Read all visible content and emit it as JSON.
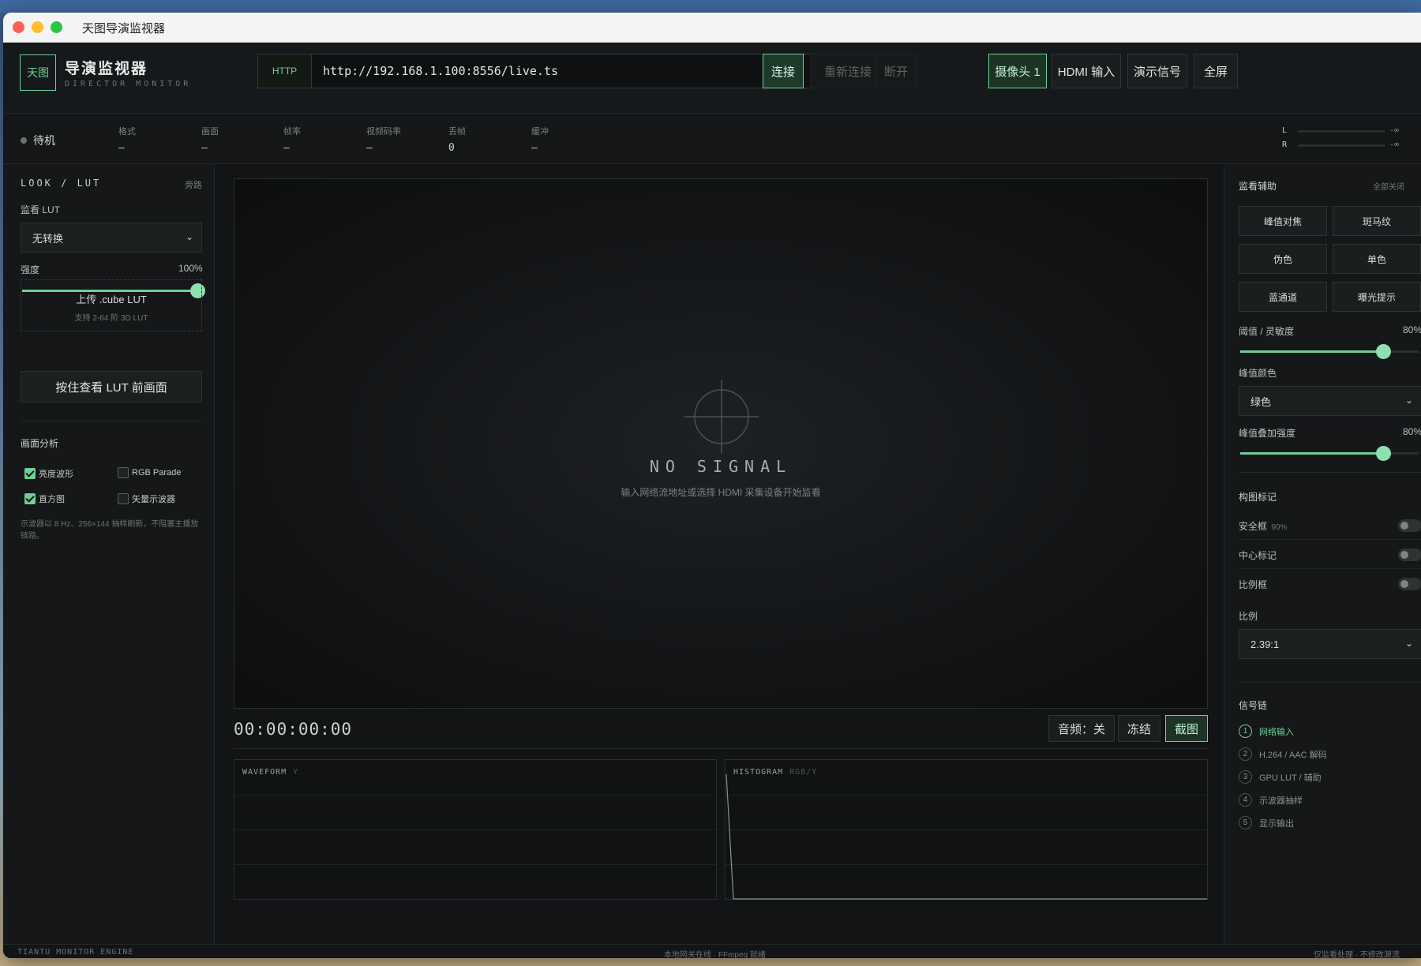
{
  "window": {
    "title": "天图导演监视器"
  },
  "header": {
    "logo": "天图",
    "app_title": "导演监视器",
    "app_subtitle": "DIRECTOR MONITOR",
    "protocol": "HTTP",
    "url": "http://192.168.1.100:8556/live.ts",
    "connect": "连接",
    "reconnect": "重新连接",
    "disconnect": "断开",
    "sources": [
      "摄像头 1",
      "HDMI 输入",
      "演示信号"
    ],
    "fullscreen": "全屏"
  },
  "status": {
    "state": "待机",
    "stats": [
      {
        "label": "格式",
        "value": "—"
      },
      {
        "label": "画面",
        "value": "—"
      },
      {
        "label": "帧率",
        "value": "—"
      },
      {
        "label": "视频码率",
        "value": "—"
      },
      {
        "label": "丢帧",
        "value": "0"
      },
      {
        "label": "缓冲",
        "value": "—"
      }
    ],
    "meters": [
      {
        "channel": "L",
        "value": "-∞",
        "level": 0
      },
      {
        "channel": "R",
        "value": "-∞",
        "level": 0
      }
    ]
  },
  "left": {
    "look_title": "LOOK / LUT",
    "bypass": "旁路",
    "lut_label": "监看 LUT",
    "lut_value": "无转换",
    "strength_label": "强度",
    "strength_value": "100%",
    "strength_level": 1.0,
    "upload_title": "上传 .cube LUT",
    "upload_sub": "支持 2-64 阶 3D LUT",
    "hold_button": "按住查看 LUT 前画面",
    "analysis_title": "画面分析",
    "checks": [
      {
        "label": "亮度波形",
        "checked": true
      },
      {
        "label": "RGB Parade",
        "checked": false
      },
      {
        "label": "直方图",
        "checked": true
      },
      {
        "label": "矢量示波器",
        "checked": false
      }
    ],
    "note": "示波器以 8 Hz、256×144 抽样刷新，不阻塞主播放链路。"
  },
  "center": {
    "no_signal": "NO SIGNAL",
    "hint": "输入网络流地址或选择 HDMI 采集设备开始监看",
    "timecode": "00:00:00:00",
    "audio": "音频：关",
    "freeze": "冻结",
    "snapshot": "截图",
    "waveform_label": "WAVEFORM",
    "waveform_sub": "Y",
    "histogram_label": "HISTOGRAM",
    "histogram_sub": "RGB/Y"
  },
  "right": {
    "assist_title": "监看辅助",
    "all_off": "全部关闭",
    "assist_buttons": [
      "峰值对焦",
      "斑马纹",
      "伪色",
      "单色",
      "蓝通道",
      "曝光提示"
    ],
    "threshold_label": "阈值 / 灵敏度",
    "threshold_value": "80%",
    "threshold_level": 0.8,
    "peak_color_label": "峰值颜色",
    "peak_color_value": "绿色",
    "overlay_label": "峰值叠加强度",
    "overlay_value": "80%",
    "overlay_level": 0.8,
    "composition_title": "构图标记",
    "safe_frame": "安全框",
    "safe_frame_sub": "90%",
    "center_mark": "中心标记",
    "ratio_frame": "比例框",
    "ratio_label": "比例",
    "ratio_value": "2.39:1",
    "chain_title": "信号链",
    "chain": [
      {
        "num": "1",
        "label": "网络输入"
      },
      {
        "num": "2",
        "label": "H.264 / AAC 解码"
      },
      {
        "num": "3",
        "label": "GPU LUT / 辅助"
      },
      {
        "num": "4",
        "label": "示波器抽样"
      },
      {
        "num": "5",
        "label": "显示输出"
      }
    ]
  },
  "footer": {
    "left": "TIANTU MONITOR ENGINE",
    "center": "本地网关在线 · FFmpeg 就绪",
    "right": "仅监看处理 · 不修改源流"
  },
  "colors": {
    "accent": "#6fcf97",
    "background": "#121416",
    "panel": "#151719"
  }
}
